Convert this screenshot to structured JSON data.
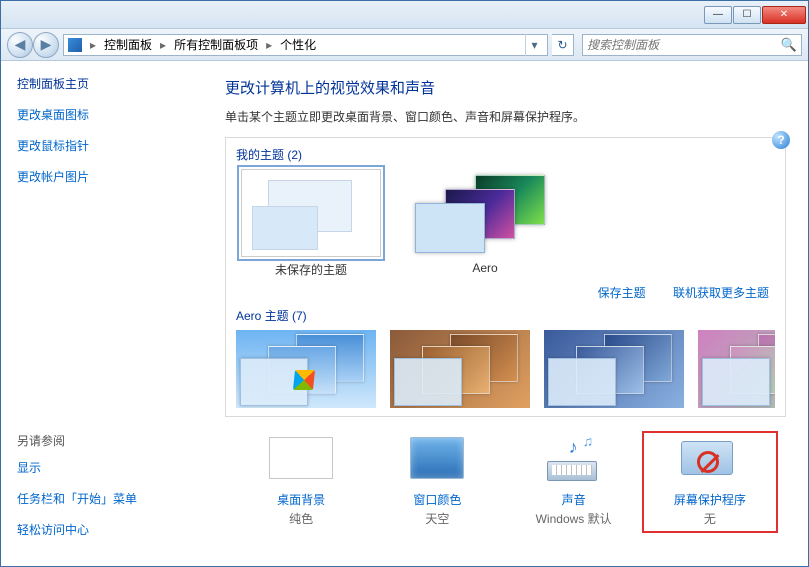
{
  "titlebar": {
    "minimize": "—",
    "maximize": "☐",
    "close": "✕"
  },
  "nav": {
    "back": "◀",
    "forward": "▶"
  },
  "breadcrumb": {
    "items": [
      "控制面板",
      "所有控制面板项",
      "个性化"
    ],
    "dropdown": "▾",
    "refresh": "↻"
  },
  "search": {
    "placeholder": "搜索控制面板",
    "icon": "🔍"
  },
  "help": {
    "glyph": "?"
  },
  "sidebar": {
    "home": "控制面板主页",
    "links": [
      "更改桌面图标",
      "更改鼠标指针",
      "更改帐户图片"
    ],
    "see_also_heading": "另请参阅",
    "see_also": [
      "显示",
      "任务栏和「开始」菜单",
      "轻松访问中心"
    ]
  },
  "main": {
    "title": "更改计算机上的视觉效果和声音",
    "desc": "单击某个主题立即更改桌面背景、窗口颜色、声音和屏幕保护程序。",
    "my_themes_label": "我的主题 (2)",
    "themes": [
      {
        "name": "未保存的主题",
        "selected": true,
        "kind": "blank"
      },
      {
        "name": "Aero",
        "selected": false,
        "kind": "aero"
      }
    ],
    "actions": {
      "save": "保存主题",
      "more": "联机获取更多主题"
    },
    "aero_label": "Aero 主题 (7)"
  },
  "quick": [
    {
      "title": "桌面背景",
      "sub": "纯色",
      "icon": "bg",
      "highlight": false
    },
    {
      "title": "窗口颜色",
      "sub": "天空",
      "icon": "color",
      "highlight": false
    },
    {
      "title": "声音",
      "sub": "Windows 默认",
      "icon": "sound",
      "highlight": false
    },
    {
      "title": "屏幕保护程序",
      "sub": "无",
      "icon": "ss",
      "highlight": true
    }
  ]
}
